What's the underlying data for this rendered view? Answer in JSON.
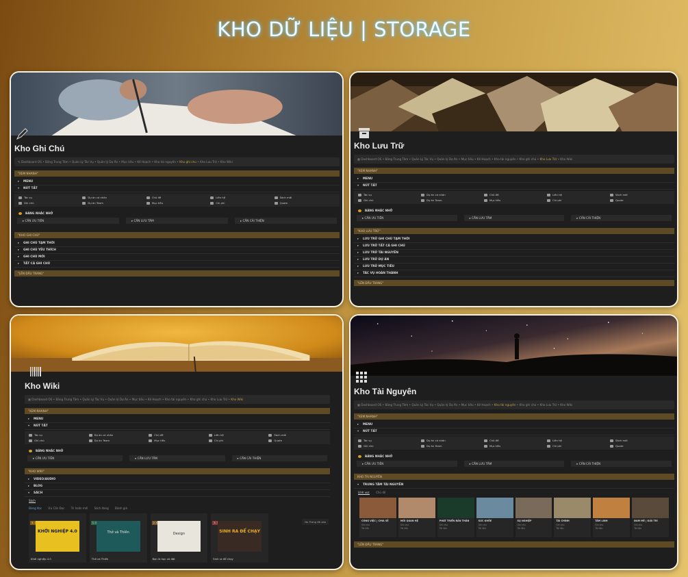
{
  "page_title": "KHO DỮ LIỆU | STORAGE",
  "breadcrumb": [
    "Dashboard OS",
    "Bảng Trung Tâm",
    "Quản Lý Tác Vụ",
    "Quản lý Dự Án",
    "Mục tiêu",
    "Kế Hoạch",
    "Kho tài nguyên",
    "Kho ghi chú",
    "Kho Lưu Trữ",
    "Kho Wiki"
  ],
  "buttons": [
    "Tác vụ",
    "Dự án cá nhân",
    "Chủ đề",
    "Liên hệ",
    "Sách mới",
    "Ghi chú",
    "Dự án Team",
    "Mục tiêu",
    "Chi phí",
    "Quote"
  ],
  "reminder": {
    "title": "BẢNG NHẮC NHỞ",
    "items": [
      "CẦN ƯU TIÊN",
      "CẦN LƯU TÂM",
      "CẦN CẢI THIỆN"
    ]
  },
  "common": {
    "band_fast": "\"XEM NHANH\"",
    "menu": "MENU",
    "nut_tat": "NÚT TẮT",
    "band_top": "\"LÊN ĐẦU TRANG\""
  },
  "cards": {
    "notes": {
      "title": "Kho Ghi Chú",
      "band": "\"KHO GHI CHÚ\"",
      "toggles": [
        "GHI CHÚ TẠM THỜI",
        "GHI CHÚ YÊU THÍCH",
        "GHI CHÚ MỚI",
        "TẤT CẢ GHI CHÚ"
      ]
    },
    "archive": {
      "title": "Kho Lưu Trữ",
      "band": "\"KHO LƯU TRỮ\"",
      "toggles": [
        "LƯU TRỮ GHI CHÚ TẠM THỜI",
        "LƯU TRỮ TẤT CẢ GHI CHÚ",
        "LƯU TRỮ TÀI NGUYÊN",
        "LƯU TRỮ DỰ ÁN",
        "LƯU TRỮ MỤC TIÊU",
        "TÁC VỤ HOÀN THÀNH"
      ]
    },
    "wiki": {
      "title": "Kho Wiki",
      "band": "\"KHO WIKI\"",
      "toggles": [
        "VIDEO/AUDIO",
        "BLOG",
        "SÁCH"
      ],
      "tab": "Sách",
      "subtabs": [
        "Đang đọc",
        "Ưu Cần Đọc",
        "Trì hoãn mới",
        "Sách đang",
        "Đánh giá"
      ],
      "books": [
        {
          "group": "3. CHƯA ĐỌC",
          "title": "Khởi nghiệp 4.0",
          "cover_text": "KHỞI NGHIỆP 4.0"
        },
        {
          "group": "1. ĐANG ĐỌC",
          "title": "Thở và Thiền",
          "cover_text": "Thở và Thiền"
        },
        {
          "group": "2. ĐÃ ĐỌC",
          "title": "Bạn là học và đặt",
          "cover_text": "Design"
        },
        {
          "group": "3. TẠM NGƯNG",
          "title": "Sinh ra để chạy",
          "cover_text": "SINH RA ĐỂ CHẠY"
        }
      ],
      "side_label": "No Trang đã xóa"
    },
    "resources": {
      "title": "Kho Tài Nguyên",
      "band": "KHO TÀI NGUYÊN",
      "toggle": "TRUNG TÂM TÀI NGUYÊN",
      "tabs": [
        "Lĩnh vực",
        "Chủ đề"
      ],
      "items": [
        "CÔNG VIỆC | CHIA SẺ",
        "MỐI QUAN HỆ",
        "PHÁT TRIỂN BẢN THÂN",
        "SỨC KHỎE",
        "SỰ NGHIỆP",
        "TÀI CHÍNH",
        "TÂM LINH",
        "ĐAM MÊ | GIẢI TRÍ"
      ],
      "meta": [
        "Ghi chú",
        "Tài liệu"
      ],
      "colors": [
        "#8a5a3a",
        "#b08a6a",
        "#1a3a2a",
        "#6a8aa0",
        "#7a6a5a",
        "#9a8a6a",
        "#c08040",
        "#5a4a3a"
      ]
    }
  }
}
